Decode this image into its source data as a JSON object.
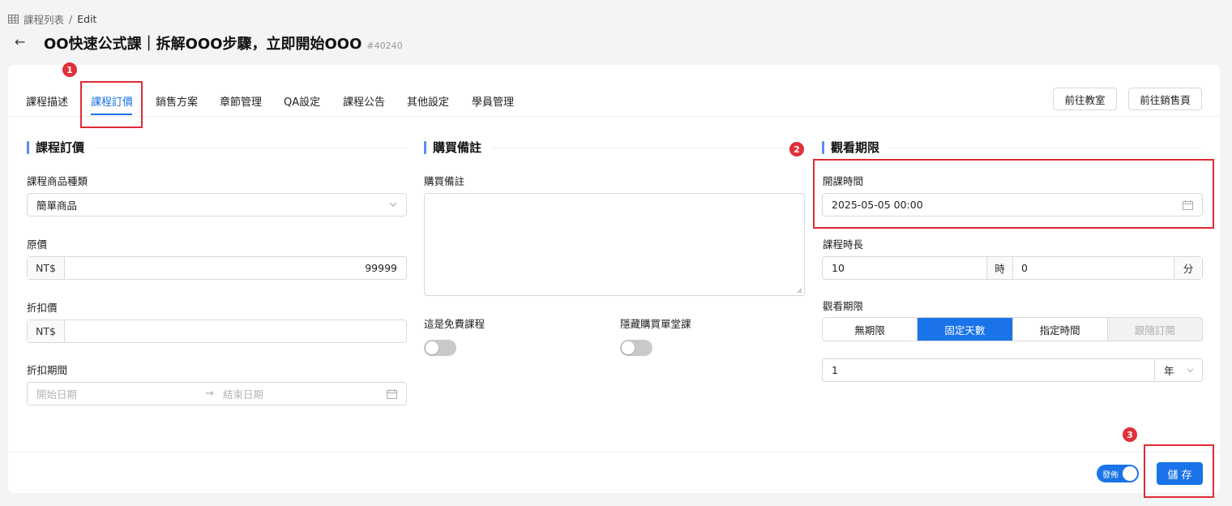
{
  "breadcrumb": {
    "root": "課程列表",
    "sep": "/",
    "current": "Edit"
  },
  "header": {
    "title": "OO快速公式課｜拆解OOO步驟，立即開始OOO",
    "id": "#40240"
  },
  "tabs": [
    {
      "label": "課程描述"
    },
    {
      "label": "課程訂價",
      "active": true
    },
    {
      "label": "銷售方案"
    },
    {
      "label": "章節管理"
    },
    {
      "label": "QA設定"
    },
    {
      "label": "課程公告"
    },
    {
      "label": "其他設定"
    },
    {
      "label": "學員管理"
    }
  ],
  "actions": {
    "classroom": "前往教室",
    "sales_page": "前往銷售頁"
  },
  "pricing": {
    "title": "課程訂價",
    "product_type_label": "課程商品種類",
    "product_type_value": "簡單商品",
    "original_price_label": "原價",
    "currency": "NT$",
    "original_price_value": "99999",
    "discount_price_label": "折扣價",
    "discount_price_value": "",
    "discount_period_label": "折扣期間",
    "start_placeholder": "開始日期",
    "end_placeholder": "結束日期"
  },
  "purchase_note": {
    "title": "購買備註",
    "field_label": "購買備註",
    "value": "",
    "free_label": "這是免費課程",
    "free_on": false,
    "hide_single_label": "隱藏購買單堂課",
    "hide_single_on": false
  },
  "viewing": {
    "title": "觀看期限",
    "start_time_label": "開課時間",
    "start_time_value": "2025-05-05 00:00",
    "duration_label": "課程時長",
    "hours_value": "10",
    "hours_unit": "時",
    "minutes_value": "0",
    "minutes_unit": "分",
    "limit_label": "觀看期限",
    "limit_options": [
      "無期限",
      "固定天數",
      "指定時間",
      "跟隨訂閱"
    ],
    "limit_selected": "固定天數",
    "amount_value": "1",
    "amount_unit": "年"
  },
  "footer": {
    "publish_label": "發佈",
    "publish_on": true,
    "save_label": "儲 存"
  },
  "annotations": {
    "badge1": "1",
    "badge2": "2",
    "badge3": "3"
  },
  "colors": {
    "primary": "#1a73e8",
    "annotation_red": "#e02b35",
    "section_bar": "#5b8def"
  }
}
